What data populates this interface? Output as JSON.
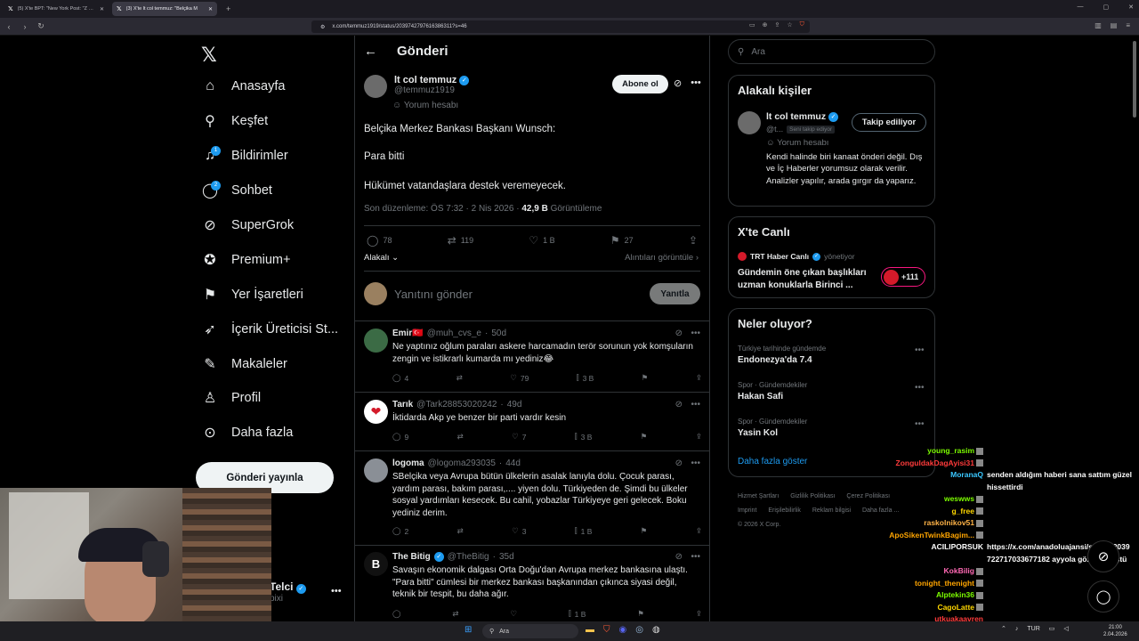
{
  "browser": {
    "tabs": [
      {
        "label": "(5) X'te BPT: \"New York Post: \"Z kuşa"
      },
      {
        "label": "(3) X'te lt col temmuz: \"Belçika M"
      }
    ],
    "url": "x.com/temmuz1919/status/2039742797616386311?s=46"
  },
  "nav": {
    "items": [
      {
        "label": "Anasayfa",
        "icon": "home-icon"
      },
      {
        "label": "Keşfet",
        "icon": "search-icon"
      },
      {
        "label": "Bildirimler",
        "icon": "bell-icon",
        "badge": "1"
      },
      {
        "label": "Sohbet",
        "icon": "chat-icon",
        "badge": "2"
      },
      {
        "label": "SuperGrok",
        "icon": "grok-icon"
      },
      {
        "label": "Premium+",
        "icon": "verified-icon"
      },
      {
        "label": "Yer İşaretleri",
        "icon": "bookmark-icon"
      },
      {
        "label": "İçerik Üreticisi St...",
        "icon": "rocket-icon"
      },
      {
        "label": "Makaleler",
        "icon": "article-icon"
      },
      {
        "label": "Profil",
        "icon": "person-icon"
      },
      {
        "label": "Daha fazla",
        "icon": "more-icon"
      }
    ],
    "post_button": "Gönderi yayınla",
    "account_name": "Telci",
    "account_handle": "pixi"
  },
  "post": {
    "header": "Gönderi",
    "author_name": "lt col temmuz",
    "author_handle": "@temmuz1919",
    "author_note": "Yorum hesabı",
    "subscribe": "Abone ol",
    "lines": [
      "Belçika Merkez Bankası Başkanı Wunsch:",
      "Para bitti",
      "Hükümet vatandaşlara destek veremeyecek."
    ],
    "meta_prefix": "Son düzenleme: ÖS 7:32 · 2 Nis 2026 · ",
    "views": "42,9 B",
    "views_label": "Görüntüleme",
    "replies": "78",
    "reposts": "119",
    "likes": "1 B",
    "bookmarks": "27",
    "sort_label": "Alakalı",
    "quotes_label": "Alıntıları görüntüle",
    "reply_placeholder": "Yanıtını gönder",
    "reply_button": "Yanıtla"
  },
  "replies": [
    {
      "name": "Emir🇹🇷",
      "handle": "@muh_cvs_e",
      "time": "50d",
      "text": "Ne yaptınız oğlum paraları askere harcamadın terör sorunun yok komşuların zengin ve istikrarlı kumarda mı yediniz😂",
      "replies": "4",
      "reposts": "",
      "likes": "79",
      "views": "3 B",
      "avatar": "#3b6b45"
    },
    {
      "name": "Tarık",
      "handle": "@Tark28853020242",
      "time": "49d",
      "text": "İktidarda Akp ye benzer bir parti vardır kesin",
      "replies": "9",
      "reposts": "",
      "likes": "7",
      "views": "3 B",
      "avatar": "#d41a2a"
    },
    {
      "name": "logoma",
      "handle": "@logoma293035",
      "time": "44d",
      "text": "SBelçika veya Avrupa bütün ülkelerin asalak lanıyla dolu. Çocuk parası, yardım parası, bakım parası,.... yiyen dolu. Türkiyeden de. Şimdi bu ülkeler sosyal yardımları kesecek. Bu cahil, yobazlar Türkiyeye geri gelecek. Boku yediniz derim.",
      "replies": "2",
      "reposts": "",
      "likes": "3",
      "views": "1 B",
      "avatar": "#8a8f96"
    },
    {
      "name": "The Bitig",
      "handle": "@TheBitig",
      "time": "35d",
      "text": "Savaşın ekonomik dalgası Orta Doğu'dan Avrupa merkez bankasına ulaştı. \"Para bitti\" cümlesi bir merkez bankası başkanından çıkınca siyasi değil, teknik bir tespit, bu daha ağır.",
      "replies": "",
      "reposts": "",
      "likes": "",
      "views": "1 B",
      "avatar": "#111111"
    }
  ],
  "sidebar": {
    "search_placeholder": "Ara",
    "related_title": "Alakalı kişiler",
    "related_name": "lt col temmuz",
    "related_handle": "@t...",
    "follows_you": "Seni takip ediyor",
    "related_note": "Yorum hesabı",
    "related_bio": "Kendi halinde biri kanaat önderi değil. Dış ve İç Haberler yorumsuz olarak verilir. Analizler yapılır, arada gırgır da yaparız.",
    "following_button": "Takip ediliyor",
    "live_title": "X'te Canlı",
    "live_host": "TRT Haber Canlı",
    "live_role": "yönetiyor",
    "live_text": "Gündemin öne çıkan başlıkları uzman konuklarla Birinci ...",
    "live_count": "+111",
    "trends_title": "Neler oluyor?",
    "trends": [
      {
        "cat": "Türkiye tarihinde gündemde",
        "name": "Endonezya'da 7.4"
      },
      {
        "cat": "Spor · Gündemdekiler",
        "name": "Hakan Safi"
      },
      {
        "cat": "Spor · Gündemdekiler",
        "name": "Yasin Kol"
      }
    ],
    "show_more": "Daha fazla göster",
    "footer_links": [
      "Hizmet Şartları",
      "Gizlilik Politikası",
      "Çerez Politikası",
      "Imprint",
      "Erişilebilirlik",
      "Reklam bilgisi",
      "Daha fazla ..."
    ],
    "copyright": "© 2026 X Corp."
  },
  "chat": [
    {
      "user": "young_rasim",
      "color": "#7cfc00",
      "msg": ""
    },
    {
      "user": "ZonguldakDagAyisi31",
      "color": "#ff3b3b",
      "msg": ""
    },
    {
      "user": "MoranaQ",
      "color": "#3ac7ff",
      "msg": "senden aldığım haberi sana sattım güzel hissettirdi"
    },
    {
      "user": "weswws",
      "color": "#7cfc00",
      "msg": ""
    },
    {
      "user": "g_free",
      "color": "#ffd700",
      "msg": ""
    },
    {
      "user": "raskolnikov51",
      "color": "#ffb347",
      "msg": ""
    },
    {
      "user": "ApoSikenTwinkBagim...",
      "color": "#ffa500",
      "msg": ""
    },
    {
      "user": "ACILIPORSUK",
      "color": "#ffffff",
      "msg": "https://x.com/anadoluajansi/status/2039722717033677182 ayyola gözden düştü"
    },
    {
      "user": "KokBilig",
      "color": "#ff69b4",
      "msg": ""
    },
    {
      "user": "tonight_thenight",
      "color": "#ffa500",
      "msg": ""
    },
    {
      "user": "Alptekin36",
      "color": "#7cfc00",
      "msg": ""
    },
    {
      "user": "CagoLatte",
      "color": "#ffd700",
      "msg": ""
    },
    {
      "user": "utkuakaavren",
      "color": "#ff3b3b",
      "msg": ""
    }
  ],
  "taskbar": {
    "search": "Ara",
    "lang": "TUR",
    "time": "21:00",
    "date": "2.04.2026"
  },
  "colors": {
    "accent": "#1d9bf0",
    "border": "#2f3336",
    "muted": "#71767b"
  }
}
